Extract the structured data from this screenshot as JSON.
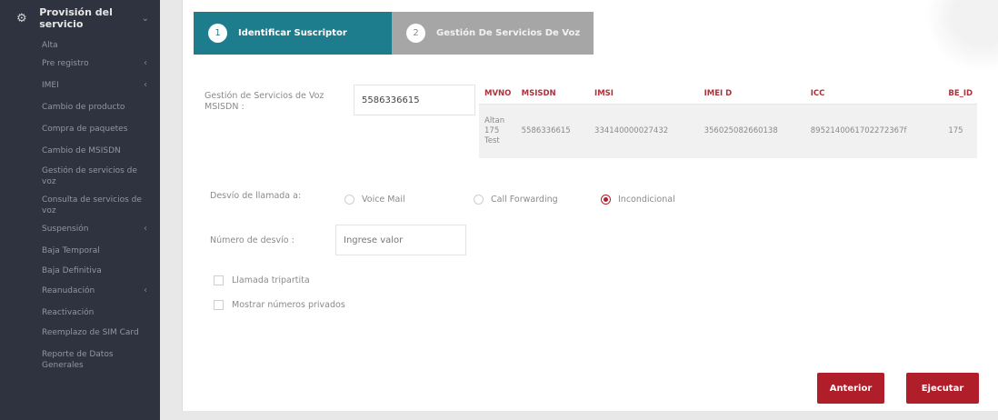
{
  "sidebar": {
    "header": {
      "title": "Provisión del servicio",
      "icon": "gear-icon"
    },
    "items": [
      {
        "label": "Alta",
        "has_arrow": false
      },
      {
        "label": "Pre registro",
        "has_arrow": true
      },
      {
        "label": "IMEI",
        "has_arrow": true
      },
      {
        "label": "Cambio de producto",
        "has_arrow": false
      },
      {
        "label": "Compra de paquetes",
        "has_arrow": false
      },
      {
        "label": "Cambio de MSISDN",
        "has_arrow": false
      },
      {
        "label": "Gestión de servicios de voz",
        "has_arrow": false
      },
      {
        "label": "Consulta de servicios de voz",
        "has_arrow": false
      },
      {
        "label": "Suspensión",
        "has_arrow": true
      },
      {
        "label": "Baja Temporal",
        "has_arrow": false
      },
      {
        "label": "Baja Definitiva",
        "has_arrow": false
      },
      {
        "label": "Reanudación",
        "has_arrow": true
      },
      {
        "label": "Reactivación",
        "has_arrow": false
      },
      {
        "label": "Reemplazo de SIM Card",
        "has_arrow": false
      },
      {
        "label": "Reporte de Datos Generales",
        "has_arrow": false
      }
    ]
  },
  "steps": [
    {
      "number": "1",
      "label": "Identificar Suscriptor",
      "active": true
    },
    {
      "number": "2",
      "label": "Gestión De Servicios De Voz",
      "active": false
    }
  ],
  "form": {
    "msisdn_label": "Gestión de Servicios de Voz MSISDN :",
    "msisdn_value": "5586336615",
    "forward_label": "Desvío de llamada a:",
    "forward_options": [
      {
        "label": "Voice Mail",
        "selected": false
      },
      {
        "label": "Call Forwarding",
        "selected": false
      },
      {
        "label": "Incondicional",
        "selected": true
      }
    ],
    "number_label": "Número de desvío :",
    "number_value": "Ingrese valor",
    "checkboxes": [
      {
        "label": "Llamada tripartita",
        "checked": false
      },
      {
        "label": "Mostrar números privados",
        "checked": false
      }
    ]
  },
  "table": {
    "headers": [
      "MVNO",
      "MSISDN",
      "IMSI",
      "IMEI D",
      "ICC",
      "BE_ID"
    ],
    "row": [
      "Altan 175 Test",
      "5586336615",
      "334140000027432",
      "356025082660138",
      "8952140061702272367f",
      "175"
    ]
  },
  "buttons": {
    "back": "Anterior",
    "execute": "Ejecutar"
  },
  "colors": {
    "accent": "#1e7d8c",
    "danger": "#b01e2a",
    "sidebar_bg": "#2e333f"
  }
}
